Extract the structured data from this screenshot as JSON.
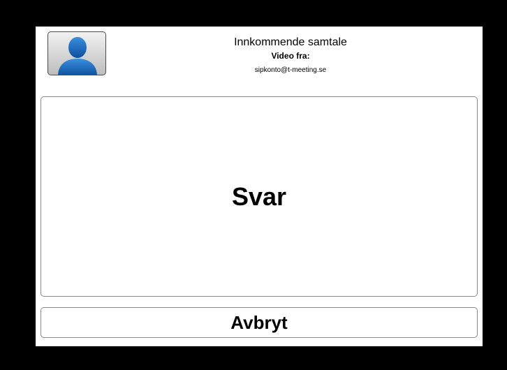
{
  "incoming_call": {
    "title": "Innkommende samtale",
    "video_from_label": "Video fra:",
    "caller_address": "sipkonto@t-meeting.se",
    "avatar_icon": "person-silhouette-icon"
  },
  "actions": {
    "answer_label": "Svar",
    "cancel_label": "Avbryt"
  },
  "colors": {
    "background": "#000000",
    "panel": "#ffffff",
    "avatar_blue": "#1565c0",
    "border": "#888888"
  }
}
